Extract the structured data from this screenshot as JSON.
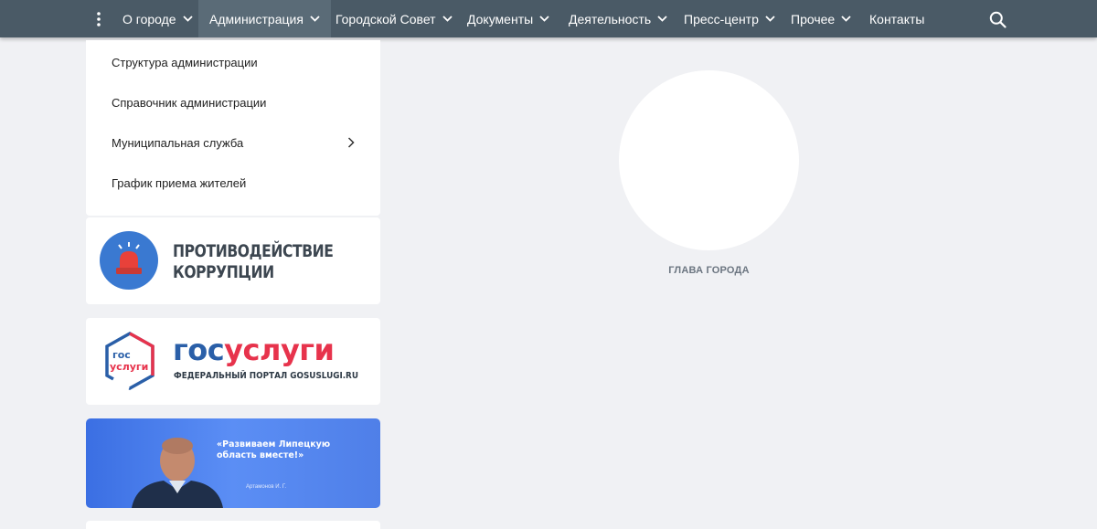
{
  "nav": {
    "menu_icon": "vertical-dots-icon",
    "items": [
      {
        "label": "О городе",
        "has_dropdown": true
      },
      {
        "label": "Администрация",
        "has_dropdown": true,
        "active": true
      },
      {
        "label": "Городской Совет",
        "has_dropdown": true
      },
      {
        "label": "Документы",
        "has_dropdown": true
      },
      {
        "label": "Деятельность",
        "has_dropdown": true
      },
      {
        "label": "Пресс-центр",
        "has_dropdown": true
      },
      {
        "label": "Прочее",
        "has_dropdown": true
      },
      {
        "label": "Контакты",
        "has_dropdown": false
      }
    ],
    "search_icon": "search-icon"
  },
  "dropdown": {
    "items": [
      {
        "label": "Структура администрации"
      },
      {
        "label": "Справочник администрации"
      },
      {
        "label": "Муниципальная служба",
        "has_submenu": true
      },
      {
        "label": "График приема жителей"
      }
    ]
  },
  "banners": {
    "anticorruption": {
      "line1": "ПРОТИВОДЕЙСТВИЕ",
      "line2": "КОРРУПЦИИ",
      "icon": "siren-icon"
    },
    "gosuslugi": {
      "title_part1": "гос",
      "title_part2": "услуги",
      "subtitle": "ФЕДЕРАЛЬНЫЙ ПОРТАЛ GOSUSLUGI.RU",
      "logo_line1": "гос",
      "logo_line2": "услуги"
    },
    "region": {
      "quote": "«Развиваем Липецкую область вместе!»",
      "signature": "Артамонов И. Г."
    }
  },
  "head": {
    "caption": "ГЛАВА ГОРОДА"
  },
  "colors": {
    "nav_bg": "#4a5a66",
    "nav_active": "#5a6b77",
    "page_bg": "#f0f1f4",
    "gos_blue": "#2a5fa8",
    "gos_red": "#e7334c",
    "anti_blue": "#3a79d1",
    "banner_blue": "#4f7fe8"
  }
}
